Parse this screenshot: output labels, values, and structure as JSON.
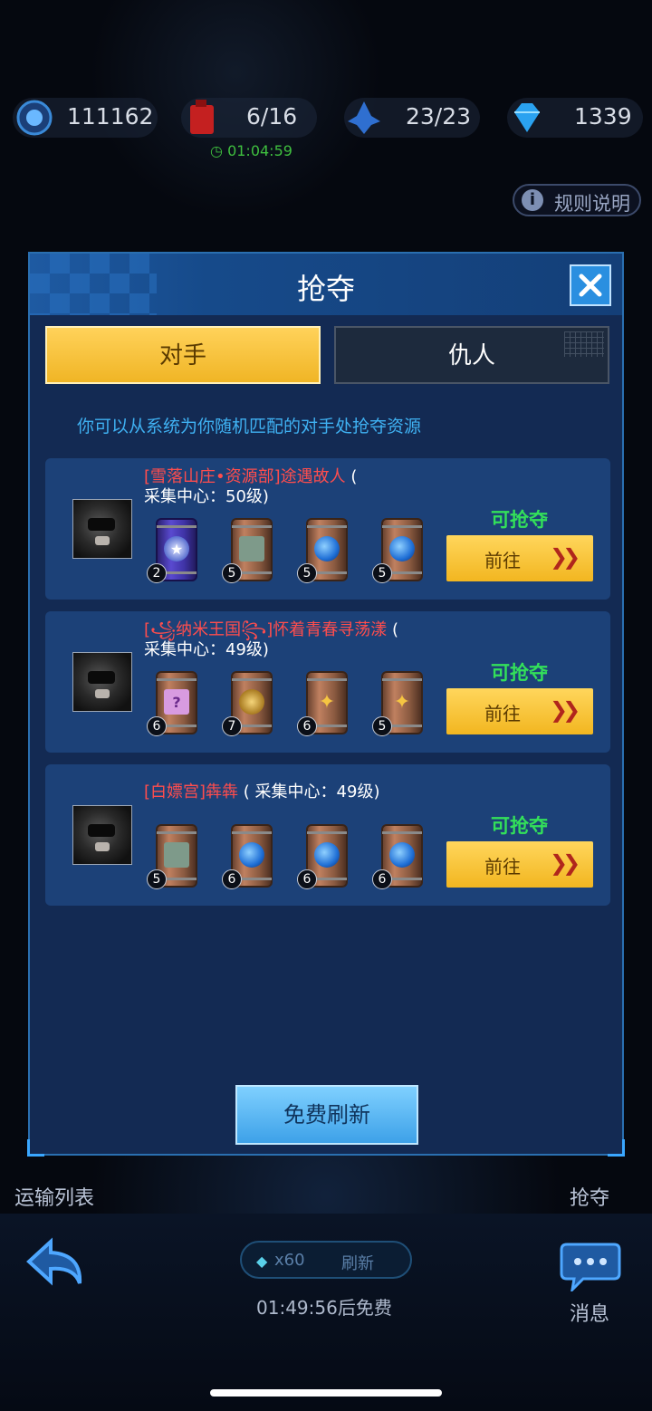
{
  "hud": {
    "credits": "111162",
    "fuel": "6/16",
    "fuel_timer": "01:04:59",
    "ships": "23/23",
    "gems": "1339",
    "rules_label": "规则说明"
  },
  "modal": {
    "title": "抢夺",
    "tabs": [
      {
        "label": "对手",
        "active": true
      },
      {
        "label": "仇人",
        "active": false
      }
    ],
    "hint": "你可以从系统为你随机匹配的对手处抢夺资源",
    "opponents": [
      {
        "name": "[雪落山庄•资源部]途遇故人",
        "paren_open": "(",
        "level": "采集中心：50级)",
        "status": "可抢夺",
        "go_label": "前往",
        "resources": [
          {
            "icon": "medal-icon",
            "count": "2"
          },
          {
            "icon": "cube-icon",
            "count": "5"
          },
          {
            "icon": "sphere-icon",
            "count": "5"
          },
          {
            "icon": "sphere-icon",
            "count": "5"
          }
        ]
      },
      {
        "name": "[꧁纳米王国꧂]怀着青春寻荡漾",
        "paren_open": "(",
        "level": "采集中心：49级)",
        "status": "可抢夺",
        "go_label": "前往",
        "resources": [
          {
            "icon": "card-icon",
            "count": "6"
          },
          {
            "icon": "gear-icon",
            "count": "7"
          },
          {
            "icon": "stars-icon",
            "count": "6"
          },
          {
            "icon": "stars-icon",
            "count": "5"
          }
        ]
      },
      {
        "name": "[白嫖宫]犇犇",
        "paren_open": "(",
        "level": "采集中心：49级)",
        "status": "可抢夺",
        "go_label": "前往",
        "resources": [
          {
            "icon": "cube-icon",
            "count": "5"
          },
          {
            "icon": "sphere-icon",
            "count": "6"
          },
          {
            "icon": "sphere-icon",
            "count": "6"
          },
          {
            "icon": "sphere-icon",
            "count": "6"
          }
        ]
      }
    ],
    "free_refresh_label": "免费刷新"
  },
  "bottom": {
    "transport_label": "运输列表",
    "rob_label": "抢夺",
    "refresh_cost": "x60",
    "refresh_label": "刷新",
    "free_timer": "01:49:56后免费",
    "message_label": "消息"
  },
  "colors": {
    "accent_yellow": "#f2b620",
    "panel_blue": "#132a53",
    "enemy_red": "#ff4d4d",
    "status_green": "#33e05a"
  }
}
